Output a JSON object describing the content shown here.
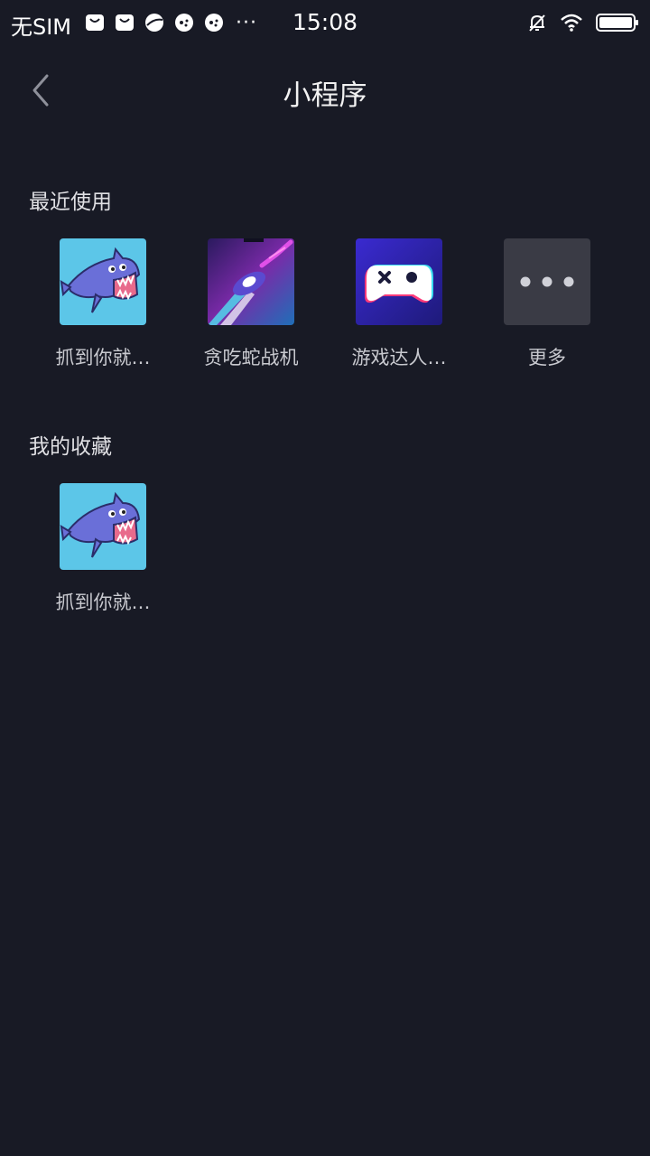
{
  "status_bar": {
    "carrier": "无SIM",
    "icons": [
      "mail-icon",
      "mail-icon",
      "browser-icon",
      "game-icon",
      "game-icon"
    ],
    "more": "···",
    "time": "15:08"
  },
  "header": {
    "title": "小程序"
  },
  "recent": {
    "title": "最近使用",
    "items": [
      {
        "label": "抓到你就…",
        "icon": "shark-game-icon"
      },
      {
        "label": "贪吃蛇战机",
        "icon": "spaceship-game-icon"
      },
      {
        "label": "游戏达人…",
        "icon": "gamepad-icon"
      },
      {
        "label": "更多",
        "icon": "more-icon"
      }
    ]
  },
  "favorites": {
    "title": "我的收藏",
    "items": [
      {
        "label": "抓到你就…",
        "icon": "shark-game-icon"
      }
    ]
  },
  "colors": {
    "background": "#181a25",
    "text": "#ffffff",
    "label": "#c8c9cf",
    "shark_bg": "#5cc6e8",
    "more_tile": "#3a3b45"
  }
}
